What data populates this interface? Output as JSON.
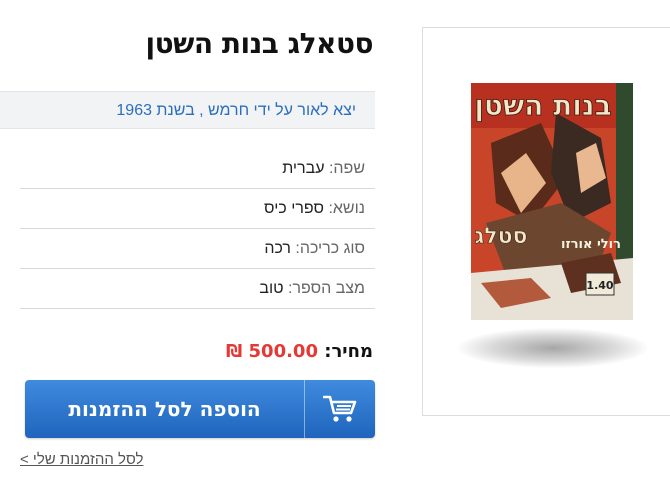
{
  "product": {
    "title": "סטאלג בנות השטן",
    "published": "יצא לאור על ידי חרמש , בשנת 1963"
  },
  "details": [
    {
      "key": "שפה:",
      "value": "עברית"
    },
    {
      "key": "נושא:",
      "value": "ספרי כיס"
    },
    {
      "key": "סוג כריכה:",
      "value": "רכה"
    },
    {
      "key": "מצב הספר:",
      "value": "טוב"
    }
  ],
  "price": {
    "label": "מחיר:",
    "value": "500.00",
    "currency": "₪"
  },
  "cart": {
    "button_label": "הוספה לסל ההזמנות",
    "icon": "shopping-cart-icon",
    "my_cart_link": "לסל ההזמנות שלי >"
  },
  "colors": {
    "accent": "#2a6fbf",
    "price": "#e53935",
    "button": "#2b73c9"
  },
  "cover": {
    "top_text": "בנות השטן",
    "side_text": "סטלג",
    "corner_text": "רולי אורזו",
    "price_tag": "1.40"
  }
}
